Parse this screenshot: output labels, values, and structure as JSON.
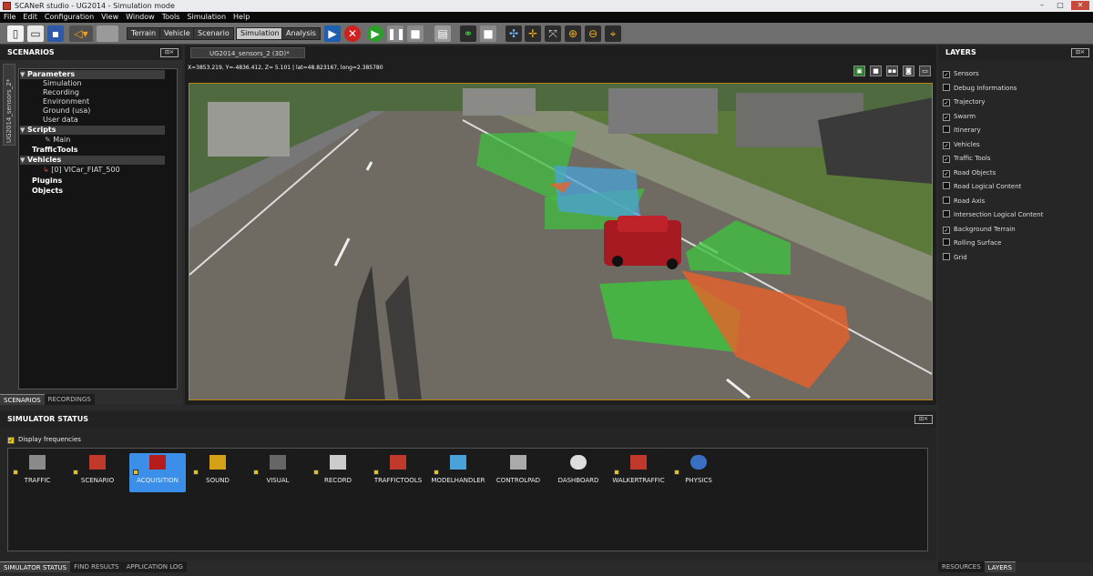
{
  "window": {
    "title": "SCANeR studio - UG2014 - Simulation mode",
    "buttons": [
      "–",
      "□",
      "✕"
    ]
  },
  "menu": [
    "File",
    "Edit",
    "Configuration",
    "View",
    "Window",
    "Tools",
    "Simulation",
    "Help"
  ],
  "toolbar": {
    "text_buttons": [
      "Terrain",
      "Vehicle",
      "Scenario",
      "Simulation",
      "Analysis"
    ],
    "active": "Simulation"
  },
  "scenarios": {
    "title": "SCENARIOS",
    "side_tab": "UG2014_sensors_2*",
    "tree": {
      "parameters": "Parameters",
      "param_children": [
        "Simulation",
        "Recording",
        "Environment",
        "Ground (usa)",
        "User data"
      ],
      "scripts": "Scripts",
      "script_children": [
        "Main"
      ],
      "traffic_tools": "TrafficTools",
      "vehicles": "Vehicles",
      "vehicle_children": [
        "[0] VICar_FIAT_500"
      ],
      "plugins": "Plugins",
      "objects": "Objects"
    },
    "tabs": [
      "SCENARIOS",
      "RECORDINGS"
    ]
  },
  "view": {
    "tab": "UG2014_sensors_2 (3D)*",
    "coords": "X=3853.219, Y=-4836.412, Z=   5.101 | lat=48.823167, long=2.385780"
  },
  "layers": {
    "title": "LAYERS",
    "items": [
      {
        "label": "Sensors",
        "checked": true
      },
      {
        "label": "Debug Informations",
        "checked": false
      },
      {
        "label": "Trajectory",
        "checked": true
      },
      {
        "label": "Swarm",
        "checked": true
      },
      {
        "label": "Itinerary",
        "checked": false
      },
      {
        "label": "Vehicles",
        "checked": true
      },
      {
        "label": "Traffic Tools",
        "checked": true
      },
      {
        "label": "Road Objects",
        "checked": true
      },
      {
        "label": "Road Logical Content",
        "checked": false
      },
      {
        "label": "Road Axis",
        "checked": false
      },
      {
        "label": "Intersection Logical Content",
        "checked": false
      },
      {
        "label": "Background Terrain",
        "checked": true
      },
      {
        "label": "Rolling Surface",
        "checked": false
      },
      {
        "label": "Grid",
        "checked": false
      }
    ],
    "tabs": [
      "RESOURCES",
      "LAYERS"
    ]
  },
  "simulator_status": {
    "title": "SIMULATOR STATUS",
    "display_frequencies": "Display frequencies",
    "modules": [
      {
        "label": "TRAFFIC",
        "color": "#8a8a8a"
      },
      {
        "label": "SCENARIO",
        "color": "#c0392b"
      },
      {
        "label": "ACQUISITION",
        "color": "#b71c1c"
      },
      {
        "label": "SOUND",
        "color": "#d4a017"
      },
      {
        "label": "VISUAL",
        "color": "#666666"
      },
      {
        "label": "RECORD",
        "color": "#cccccc"
      },
      {
        "label": "TRAFFICTOOLS",
        "color": "#c0392b"
      },
      {
        "label": "MODELHANDLER",
        "color": "#4aa3d8"
      },
      {
        "label": "CONTROLPAD",
        "color": "#aaaaaa"
      },
      {
        "label": "DASHBOARD",
        "color": "#dddddd"
      },
      {
        "label": "WALKERTRAFFIC",
        "color": "#c0392b"
      },
      {
        "label": "PHYSICS",
        "color": "#3a6fc4"
      }
    ],
    "selected": "ACQUISITION",
    "tabs": [
      "SIMULATOR STATUS",
      "FIND RESULTS",
      "APPLICATION LOG"
    ]
  }
}
